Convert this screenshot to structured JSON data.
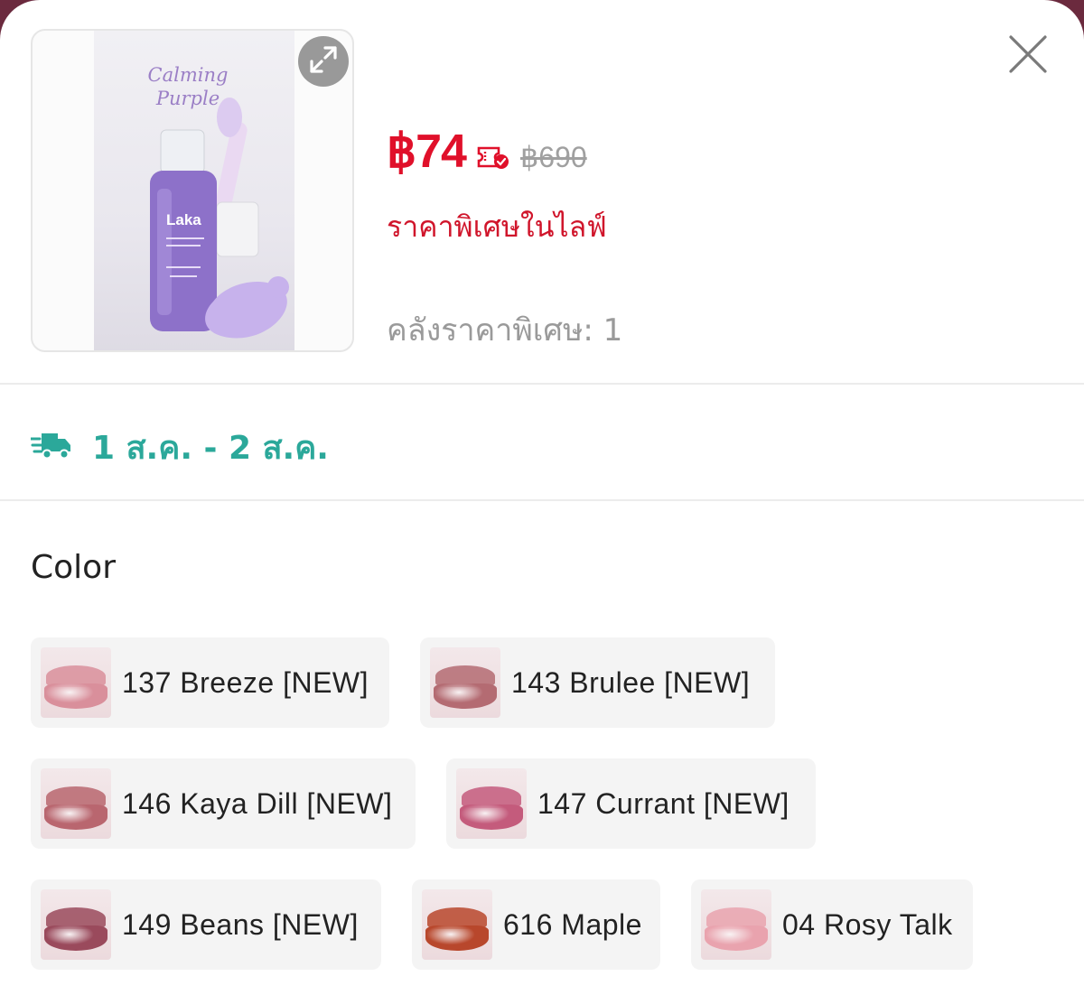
{
  "product": {
    "image_title_line1": "Calming",
    "image_title_line2": "Purple",
    "image_brand": "Laka",
    "price": "฿74",
    "original_price": "฿690",
    "promo_label": "ราคาพิเศษในไลฟ์",
    "stock_text": "คลังราคาพิเศษ: 1",
    "price_color": "#e0102a"
  },
  "shipping": {
    "date_range": "1 ส.ค. - 2 ส.ค.",
    "icon": "delivery-truck-icon",
    "color": "#2ba89a"
  },
  "options": {
    "title": "Color",
    "items": [
      {
        "label": "137 Breeze [NEW]",
        "swatch": "#d98f9b"
      },
      {
        "label": "143 Brulee [NEW]",
        "swatch": "#b46b72"
      },
      {
        "label": "146 Kaya Dill [NEW]",
        "swatch": "#b9666f"
      },
      {
        "label": "147 Currant [NEW]",
        "swatch": "#c45b7c"
      },
      {
        "label": "149 Beans [NEW]",
        "swatch": "#9a4a5c"
      },
      {
        "label": "616 Maple",
        "swatch": "#b8472c"
      },
      {
        "label": "04 Rosy Talk",
        "swatch": "#e9a3ae"
      }
    ]
  },
  "icons": {
    "expand": "expand-icon",
    "close": "close-icon",
    "coupon": "coupon-check-icon"
  }
}
